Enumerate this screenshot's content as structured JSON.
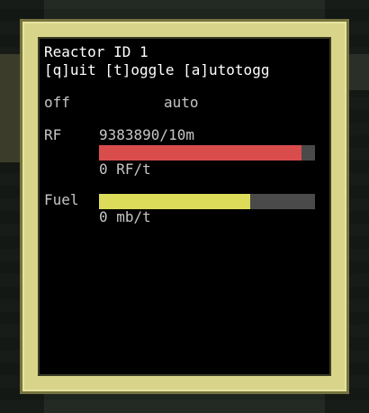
{
  "reactor": {
    "title": "Reactor ID 1",
    "controls": "[q]uit [t]oggle [a]utotogg",
    "state": "off",
    "mode": "auto"
  },
  "rf": {
    "label": "RF",
    "value": "9383890/10m",
    "fraction": 0.938,
    "rate": "0 RF/t",
    "color": "#d94c4c"
  },
  "fuel": {
    "label": "Fuel",
    "fraction": 0.7,
    "rate": "0 mb/t",
    "color": "#dcdc5a"
  },
  "colors": {
    "frame": "#d8d58a",
    "track": "#4a4a4a"
  }
}
